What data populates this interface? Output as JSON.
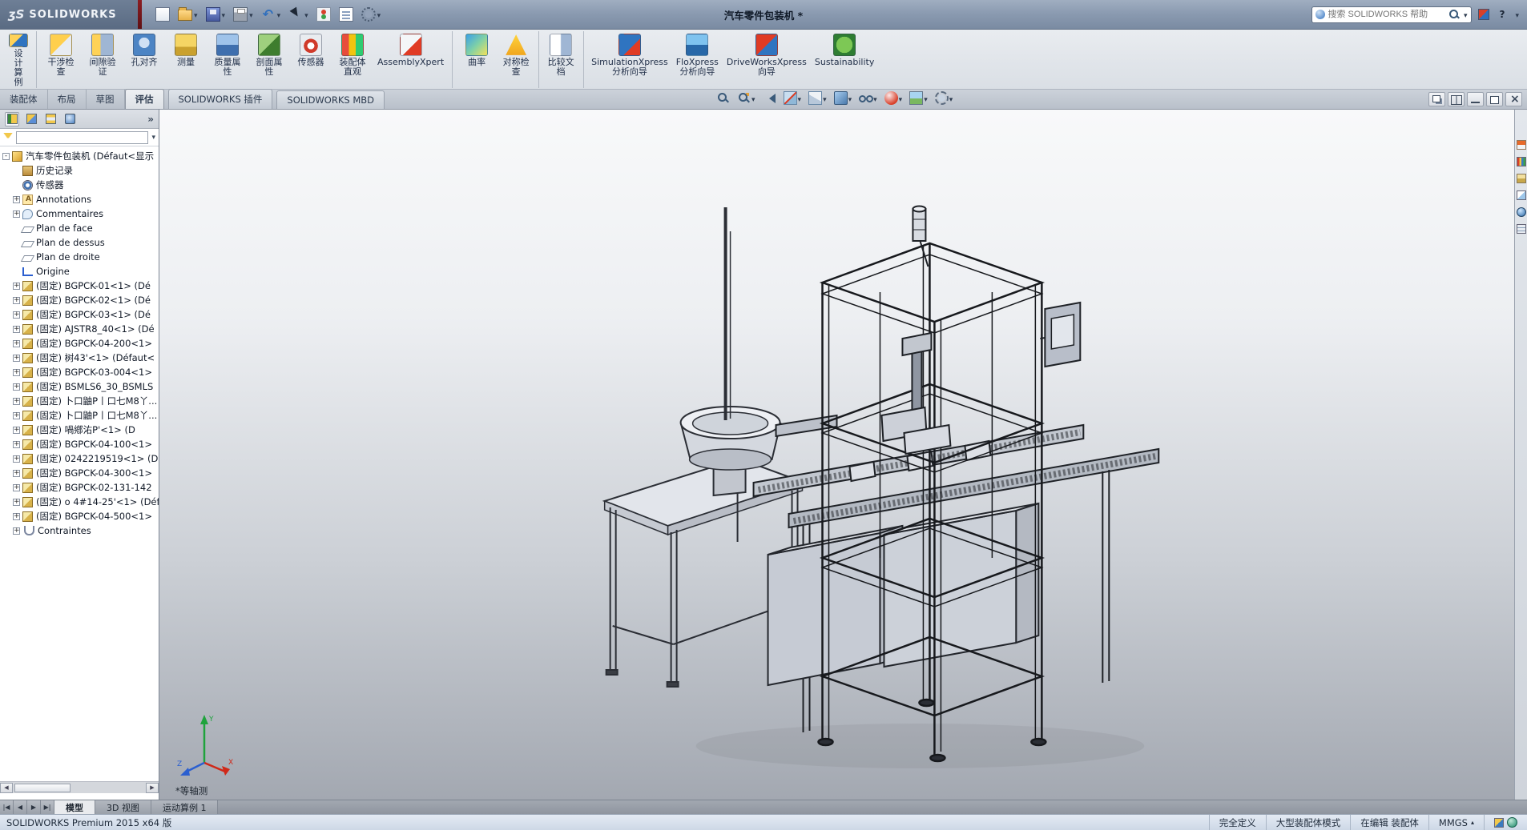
{
  "titlebar": {
    "logo_mark": "ʒS",
    "logo_text": "SOLIDWORKS",
    "document_title": "汽车零件包装机 *",
    "search": {
      "placeholder": "搜索 SOLIDWORKS 帮助"
    },
    "help_label": "?",
    "quick_tools": [
      {
        "icon": "new-document-icon"
      },
      {
        "icon": "open-icon",
        "arrow": "has-arrow"
      },
      {
        "icon": "save-icon",
        "arrow": "has-arrow"
      },
      {
        "icon": "print-icon",
        "arrow": "has-arrow"
      },
      {
        "icon": "undo-icon",
        "arrow": "has-arrow"
      },
      {
        "icon": "select-icon",
        "arrow": "has-arrow"
      },
      {
        "icon": "rebuild-icon"
      },
      {
        "icon": "file-properties-icon"
      },
      {
        "icon": "options-icon",
        "arrow": "has-arrow"
      }
    ]
  },
  "ribbon": {
    "tools": [
      {
        "icon": "design-study-icon",
        "label": "设计算例",
        "cls": "vertical group-end"
      },
      {
        "icon": "interference-check-icon",
        "label": "干涉检\n查"
      },
      {
        "icon": "clearance-verify-icon",
        "label": "间隙验\n证"
      },
      {
        "icon": "hole-align-icon",
        "label": "孔对齐"
      },
      {
        "icon": "measure-icon",
        "label": "测量"
      },
      {
        "icon": "mass-properties-icon",
        "label": "质量属\n性"
      },
      {
        "icon": "section-properties-icon",
        "label": "剖面属\n性"
      },
      {
        "icon": "sensor-icon",
        "label": "传感器"
      },
      {
        "icon": "assembly-visualization-icon",
        "label": "装配体\n直观"
      },
      {
        "icon": "assemblyxpert-icon",
        "label": "AssemblyXpert",
        "cls": "group-end"
      },
      {
        "icon": "curvature-icon",
        "label": "曲率"
      },
      {
        "icon": "symmetry-check-icon",
        "label": "对称检\n查",
        "cls": "group-end"
      },
      {
        "icon": "compare-documents-icon",
        "label": "比较文\n档",
        "cls": "group-end"
      },
      {
        "icon": "simulationxpress-icon",
        "label": "SimulationXpress\n分析向导"
      },
      {
        "icon": "floxpress-icon",
        "label": "FloXpress\n分析向导"
      },
      {
        "icon": "driveworksxpress-icon",
        "label": "DriveWorksXpress\n向导"
      },
      {
        "icon": "sustainability-icon",
        "label": "Sustainability"
      }
    ]
  },
  "command_tabs": [
    {
      "label": "装配体"
    },
    {
      "label": "布局"
    },
    {
      "label": "草图"
    },
    {
      "label": "评估",
      "cls": "active"
    },
    {
      "label": "SOLIDWORKS 插件",
      "cls": "addin"
    },
    {
      "label": "SOLIDWORKS MBD",
      "cls": "addin"
    }
  ],
  "headsup": [
    {
      "icon": "zoom-fit-icon"
    },
    {
      "icon": "zoom-area-icon",
      "arrow": "has-arrow"
    },
    {
      "icon": "previous-view-icon"
    },
    {
      "icon": "section-view-icon",
      "arrow": "has-arrow"
    },
    {
      "icon": "view-orientation-icon",
      "arrow": "has-arrow"
    },
    {
      "icon": "display-style-icon",
      "arrow": "has-arrow"
    },
    {
      "icon": "hide-show-items-icon",
      "arrow": "has-arrow"
    },
    {
      "icon": "edit-appearance-icon",
      "arrow": "has-arrow"
    },
    {
      "icon": "apply-scene-icon",
      "arrow": "has-arrow"
    },
    {
      "icon": "view-settings-icon",
      "arrow": "has-arrow"
    }
  ],
  "window_controls": [
    {
      "icon": "cascade-windows-icon"
    },
    {
      "icon": "tile-windows-icon"
    },
    {
      "icon": "minimize-icon"
    },
    {
      "icon": "restore-icon"
    },
    {
      "icon": "close-icon"
    }
  ],
  "feature_panel": {
    "tabs": [
      {
        "icon": "featuremanager-icon",
        "cls": "active"
      },
      {
        "icon": "propertymanager-icon"
      },
      {
        "icon": "configurationmanager-icon"
      },
      {
        "icon": "displaymanager-icon"
      }
    ],
    "overflow_label": "»",
    "tree": [
      {
        "exp": "-",
        "icon": "assembly-icon",
        "label": "汽车零件包装机 (Défaut<显示",
        "cls": "has-exp root"
      },
      {
        "exp": "",
        "icon": "history-folder-icon",
        "label": "历史记录",
        "cls": ""
      },
      {
        "exp": "",
        "icon": "sensors-icon",
        "label": "传感器",
        "cls": ""
      },
      {
        "exp": "+",
        "icon": "annotations-icon",
        "label": "Annotations",
        "cls": "has-exp"
      },
      {
        "exp": "+",
        "icon": "comments-icon",
        "label": "Commentaires",
        "cls": "has-exp"
      },
      {
        "exp": "",
        "icon": "plane-icon",
        "label": "Plan de face",
        "cls": ""
      },
      {
        "exp": "",
        "icon": "plane-icon",
        "label": "Plan de dessus",
        "cls": ""
      },
      {
        "exp": "",
        "icon": "plane-icon",
        "label": "Plan de droite",
        "cls": ""
      },
      {
        "exp": "",
        "icon": "origin-icon",
        "label": "Origine",
        "cls": ""
      },
      {
        "exp": "+",
        "icon": "component-icon",
        "label": "(固定) BGPCK-01<1> (Dé",
        "cls": "has-exp"
      },
      {
        "exp": "+",
        "icon": "component-icon",
        "label": "(固定) BGPCK-02<1> (Dé",
        "cls": "has-exp"
      },
      {
        "exp": "+",
        "icon": "component-icon",
        "label": "(固定) BGPCK-03<1> (Dé",
        "cls": "has-exp"
      },
      {
        "exp": "+",
        "icon": "component-icon",
        "label": "(固定) AJSTR8_40<1> (Dé",
        "cls": "has-exp"
      },
      {
        "exp": "+",
        "icon": "component-icon",
        "label": "(固定) BGPCK-04-200<1>",
        "cls": "has-exp"
      },
      {
        "exp": "+",
        "icon": "component-icon",
        "label": "(固定) 树43'<1> (Défaut<",
        "cls": "has-exp"
      },
      {
        "exp": "+",
        "icon": "component-icon",
        "label": "(固定) BGPCK-03-004<1>",
        "cls": "has-exp"
      },
      {
        "exp": "+",
        "icon": "component-icon",
        "label": "(固定) BSMLS6_30_BSMLS",
        "cls": "has-exp"
      },
      {
        "exp": "+",
        "icon": "component-icon",
        "label": "(固定) 卜口鼬P丨口七M8丫...",
        "cls": "has-exp"
      },
      {
        "exp": "+",
        "icon": "component-icon",
        "label": "(固定) 卜口鼬P丨口七M8丫...",
        "cls": "has-exp"
      },
      {
        "exp": "+",
        "icon": "component-icon",
        "label": "(固定) 喎鄕㳓P'<1> (D",
        "cls": "has-exp"
      },
      {
        "exp": "+",
        "icon": "component-icon",
        "label": "(固定) BGPCK-04-100<1>",
        "cls": "has-exp"
      },
      {
        "exp": "+",
        "icon": "component-icon",
        "label": "(固定) 0242219519<1> (D",
        "cls": "has-exp"
      },
      {
        "exp": "+",
        "icon": "component-icon",
        "label": "(固定) BGPCK-04-300<1>",
        "cls": "has-exp"
      },
      {
        "exp": "+",
        "icon": "component-icon",
        "label": "(固定) BGPCK-02-131-142",
        "cls": "has-exp"
      },
      {
        "exp": "+",
        "icon": "component-icon",
        "label": "(固定) o 4#14-25'<1> (Déf",
        "cls": "has-exp"
      },
      {
        "exp": "+",
        "icon": "component-icon",
        "label": "(固定) BGPCK-04-500<1>",
        "cls": "has-exp"
      },
      {
        "exp": "+",
        "icon": "mates-icon",
        "label": "Contraintes",
        "cls": "has-exp"
      }
    ]
  },
  "viewport": {
    "view_label": "*等轴测",
    "triad_labels": {
      "x": "X",
      "y": "Y",
      "z": "Z"
    }
  },
  "task_pane": {
    "icons": [
      {
        "icon": "resources-home-icon"
      },
      {
        "icon": "design-library-icon"
      },
      {
        "icon": "file-explorer-icon"
      },
      {
        "icon": "view-palette-icon"
      },
      {
        "icon": "appearances-icon"
      },
      {
        "icon": "custom-properties-icon"
      }
    ]
  },
  "model_tabs": {
    "items": [
      {
        "label": "模型",
        "cls": "active"
      },
      {
        "label": "3D 视图"
      },
      {
        "label": "运动算例 1"
      }
    ]
  },
  "statusbar": {
    "product": "SOLIDWORKS Premium 2015 x64 版",
    "defined": "完全定义",
    "mode": "大型装配体模式",
    "editing": "在编辑 装配体",
    "units": "MMGS"
  }
}
